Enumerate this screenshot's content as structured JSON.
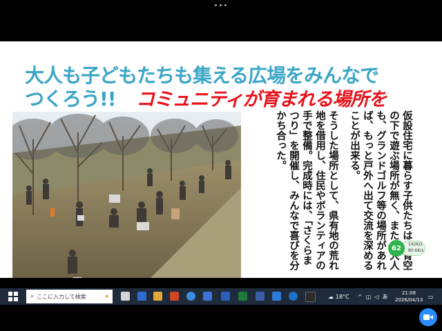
{
  "window": {
    "dots": "•••"
  },
  "slide": {
    "title_line1": "大人も子どもたちも集える広場をみんなで",
    "title_line2": "つくろう!!",
    "title_highlight": "コミュニティが育まれる場所を",
    "paragraphs": [
      "仮設住宅に暮らす子供たちは、青空の下で遊ぶ場所が無く、また、大人も、グランドゴルフ等の場所があれば、もっと戸外へ出て交流を深めることが出来る。",
      "そうした場所として、県有地の荒れ地を借用し、住民やボランティアの手で整備。完成時には、「さくらまつり」を開催し、みんなで喜びを分かち合った。"
    ]
  },
  "speed_widget": {
    "percent": "62",
    "up": "142K/s",
    "down": "80.6K/s"
  },
  "taskbar": {
    "search_placeholder": "ここに入力して検索",
    "weather": "18°C",
    "time": "21:08",
    "date": "2026/04/13"
  },
  "colors": {
    "title": "#3aa6c5",
    "highlight": "#e6121c",
    "taskbar": "#1f2a3a",
    "zoom": "#2b8cff"
  }
}
